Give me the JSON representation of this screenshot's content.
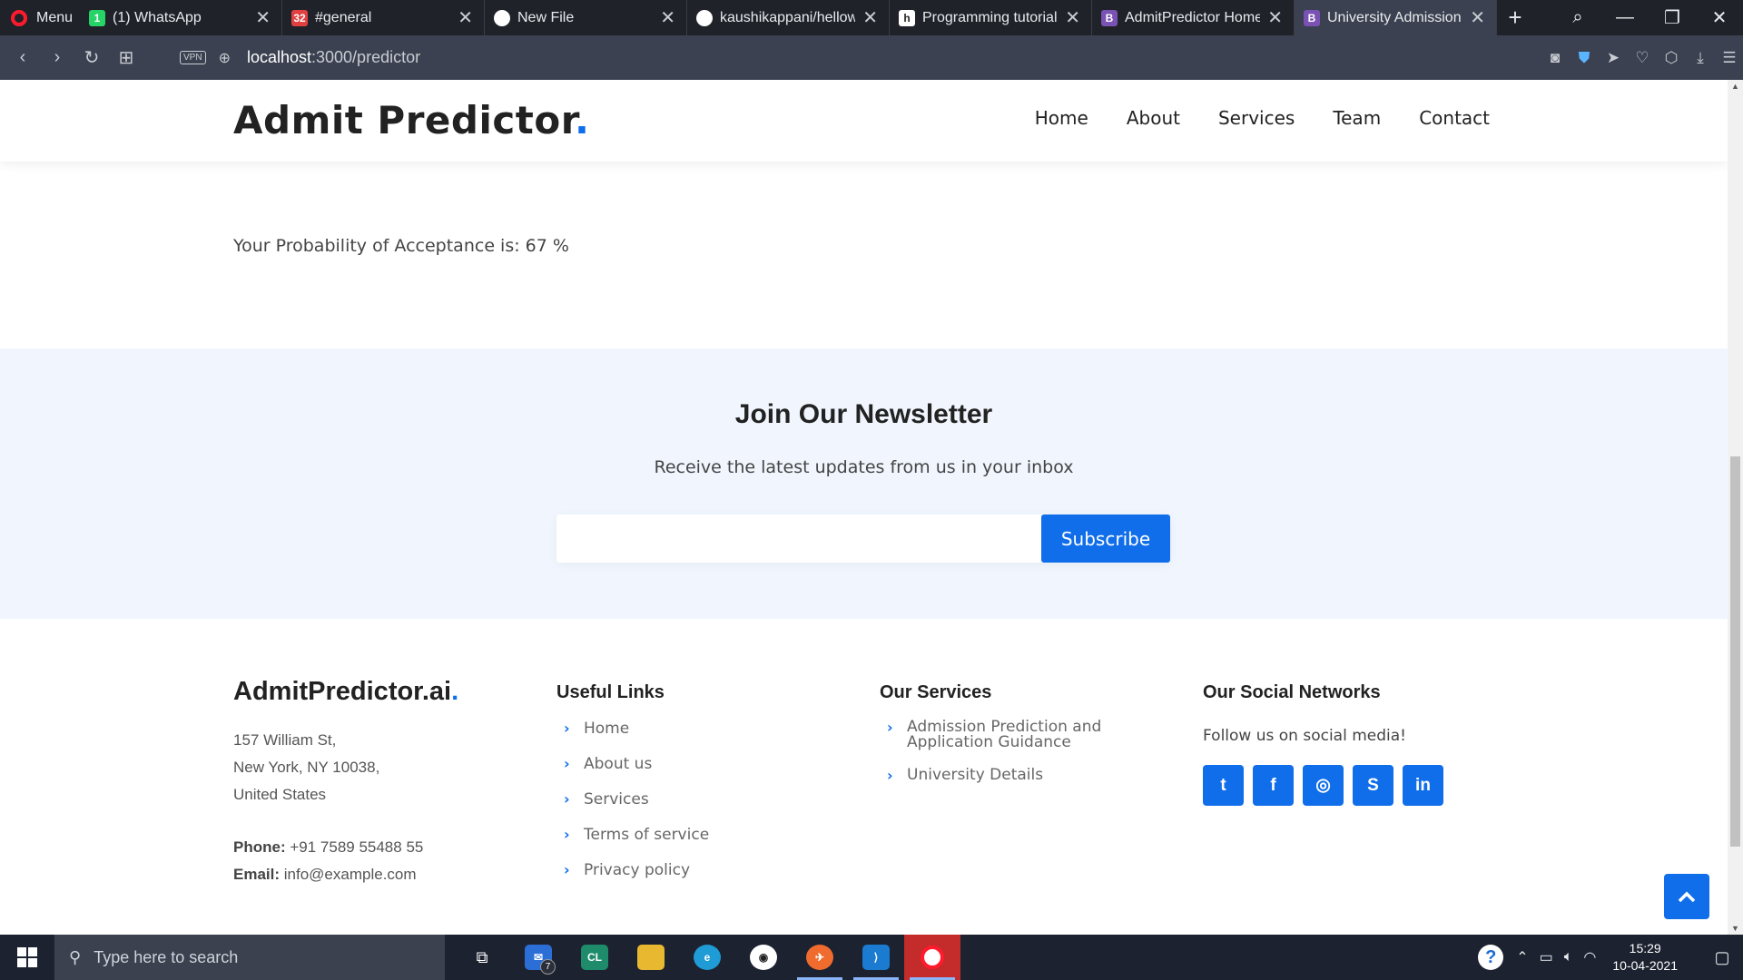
{
  "browser": {
    "menu_label": "Menu",
    "tabs": [
      {
        "title": "(1) WhatsApp",
        "favicon": "whatsapp-icon",
        "fav_text": "1",
        "fav_color": "#25d366"
      },
      {
        "title": "#general",
        "favicon": "calendar-icon",
        "fav_text": "32",
        "fav_color": "#e04040"
      },
      {
        "title": "New File",
        "favicon": "github-icon",
        "fav_text": "",
        "fav_color": "#ffffff"
      },
      {
        "title": "kaushikappani/hellowo",
        "favicon": "github-icon",
        "fav_text": "",
        "fav_color": "#ffffff"
      },
      {
        "title": "Programming tutorials,",
        "favicon": "hashnode-icon",
        "fav_text": "h",
        "fav_color": "#ffffff"
      },
      {
        "title": "AdmitPredictor Home",
        "favicon": "bootstrap-icon",
        "fav_text": "B",
        "fav_color": "#7952b3"
      },
      {
        "title": "University Admission P",
        "favicon": "bootstrap-icon",
        "fav_text": "B",
        "fav_color": "#7952b3"
      }
    ],
    "active_tab": 6,
    "vpn_label": "VPN",
    "url_host": "localhost",
    "url_path": ":3000/predictor"
  },
  "site": {
    "logo_text": "Admit Predictor",
    "logo_dot": ".",
    "nav": [
      "Home",
      "About",
      "Services",
      "Team",
      "Contact"
    ],
    "result_text": "Your Probability of Acceptance is: 67 %",
    "newsletter": {
      "title": "Join Our Newsletter",
      "subtitle": "Receive the latest updates from us in your inbox",
      "email_value": "",
      "button": "Subscribe"
    },
    "footer": {
      "brand": "AdmitPredictor.ai",
      "brand_dot": ".",
      "address": [
        "157 William St,",
        "New York, NY 10038,",
        "United States"
      ],
      "phone_label": "Phone:",
      "phone": "+91 7589 55488 55",
      "email_label": "Email:",
      "email": "info@example.com",
      "links_title": "Useful Links",
      "links": [
        "Home",
        "About us",
        "Services",
        "Terms of service",
        "Privacy policy"
      ],
      "services_title": "Our Services",
      "services": [
        "Admission Prediction and\nApplication Guidance",
        "University Details"
      ],
      "social_title": "Our Social Networks",
      "social_text": "Follow us on social media!",
      "socials": [
        {
          "name": "twitter-icon",
          "glyph": "t"
        },
        {
          "name": "facebook-icon",
          "glyph": "f"
        },
        {
          "name": "instagram-icon",
          "glyph": "◎"
        },
        {
          "name": "skype-icon",
          "glyph": "S"
        },
        {
          "name": "linkedin-icon",
          "glyph": "in"
        }
      ]
    },
    "accent_color": "#106eea"
  },
  "taskbar": {
    "search_placeholder": "Type here to search",
    "mail_badge": "7",
    "time": "15:29",
    "date": "10-04-2021"
  }
}
